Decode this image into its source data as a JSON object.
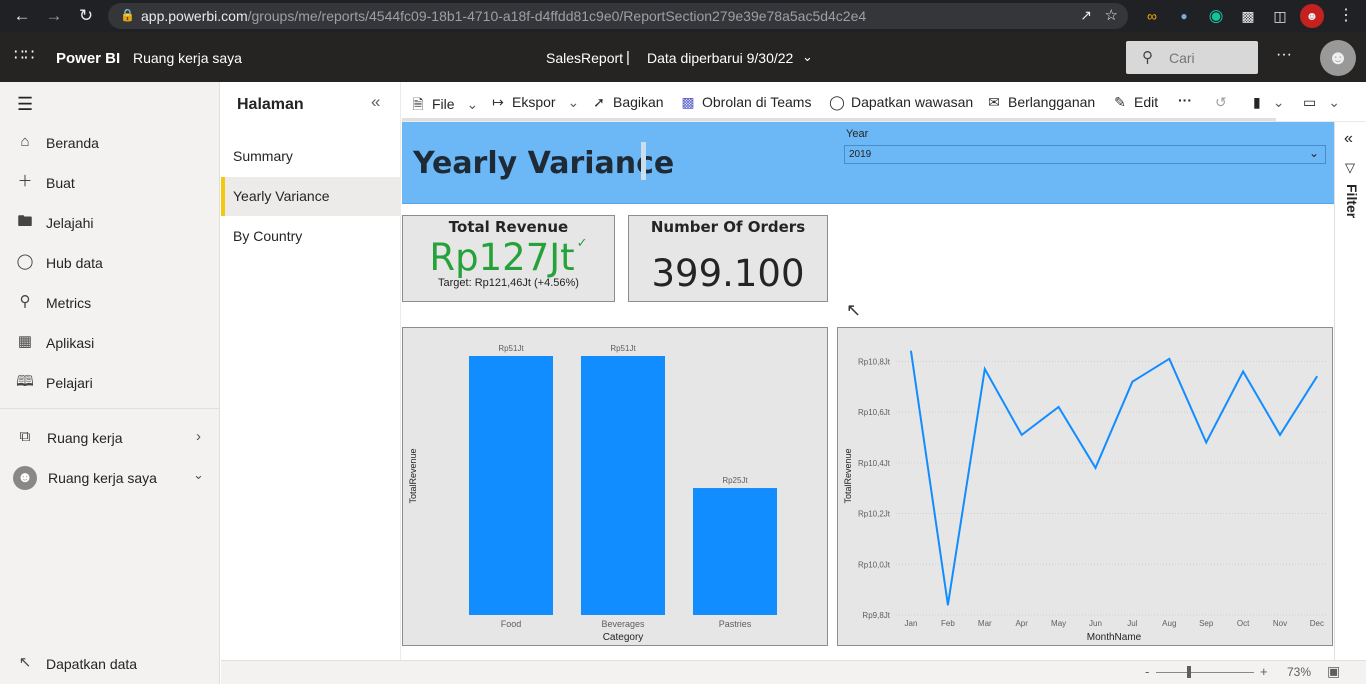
{
  "browser": {
    "url_domain": "app.powerbi.com",
    "url_path": "/groups/me/reports/4544fc09-18b1-4710-a18f-d4ffdd81c9e0/ReportSection279e39e78a5ac5d4c2e4"
  },
  "appbar": {
    "brand": "Power BI",
    "workspace": "Ruang kerja saya",
    "report_name": "SalesReport",
    "separator": "|",
    "data_updated": "Data diperbarui 9/30/22",
    "search_placeholder": "Cari"
  },
  "leftnav": {
    "items": [
      {
        "label": "Beranda",
        "icon": "home-icon"
      },
      {
        "label": "Buat",
        "icon": "plus-icon"
      },
      {
        "label": "Jelajahi",
        "icon": "folder-icon"
      },
      {
        "label": "Hub data",
        "icon": "database-icon"
      },
      {
        "label": "Metrics",
        "icon": "trophy-icon"
      },
      {
        "label": "Aplikasi",
        "icon": "apps-icon"
      },
      {
        "label": "Pelajari",
        "icon": "book-icon"
      }
    ],
    "workspaces": "Ruang kerja",
    "my_workspace": "Ruang kerja saya",
    "get_data": "Dapatkan data"
  },
  "pages": {
    "header": "Halaman",
    "items": [
      "Summary",
      "Yearly Variance",
      "By Country"
    ],
    "active": "Yearly Variance"
  },
  "toolbar": {
    "file": "File",
    "export": "Ekspor",
    "share": "Bagikan",
    "teams": "Obrolan di Teams",
    "insights": "Dapatkan wawasan",
    "subscribe": "Berlangganan",
    "edit": "Edit",
    "more": "···"
  },
  "report": {
    "title": "Yearly Variance",
    "slicer_label": "Year",
    "slicer_value": "2019"
  },
  "kpi_revenue": {
    "title": "Total Revenue",
    "value": "Rp127Jt",
    "check": "✓",
    "target": "Target: Rp121,46Jt (+4.56%)"
  },
  "kpi_orders": {
    "title": "Number Of Orders",
    "value": "399.100"
  },
  "filter_pane": {
    "label": "Filter"
  },
  "statusbar": {
    "zoom_minus": "-",
    "zoom_plus": "+",
    "zoom": "73%"
  },
  "colors": {
    "bar": "#118dff",
    "line": "#118dff",
    "banner": "#6cb8f6",
    "kpi_green": "#27a23a",
    "active_page_accent": "#f2c811"
  },
  "chart_data": [
    {
      "type": "bar",
      "categories": [
        "Food",
        "Beverages",
        "Pastries"
      ],
      "values": [
        51,
        51,
        25
      ],
      "data_labels": [
        "Rp51Jt",
        "Rp51Jt",
        "Rp25Jt"
      ],
      "xlabel": "Category",
      "ylabel": "TotalRevenue",
      "ylim": [
        0,
        51
      ]
    },
    {
      "type": "line",
      "x": [
        "Jan",
        "Feb",
        "Mar",
        "Apr",
        "May",
        "Jun",
        "Jul",
        "Aug",
        "Sep",
        "Oct",
        "Nov",
        "Dec"
      ],
      "values": [
        10.84,
        9.84,
        10.77,
        10.51,
        10.62,
        10.38,
        10.72,
        10.81,
        10.48,
        10.76,
        10.51,
        10.74
      ],
      "y_ticks": [
        "Rp9,8Jt",
        "Rp10,0Jt",
        "Rp10,2Jt",
        "Rp10,4Jt",
        "Rp10,6Jt",
        "Rp10,8Jt"
      ],
      "y_tick_values": [
        9.8,
        10.0,
        10.2,
        10.4,
        10.6,
        10.8
      ],
      "xlabel": "MonthName",
      "ylabel": "TotalRevenue",
      "ylim": [
        9.8,
        10.9
      ]
    }
  ]
}
